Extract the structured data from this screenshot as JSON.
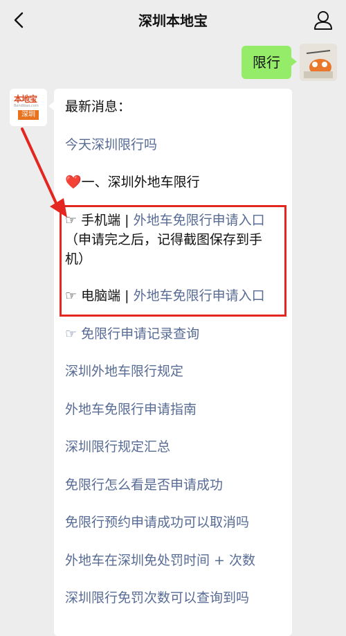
{
  "header": {
    "title": "深圳本地宝"
  },
  "outgoing_message": "限行",
  "bot_avatar": {
    "brand": "本地宝",
    "domain": "Bendibao.com",
    "city": "深圳"
  },
  "message": {
    "heading": "最新消息：",
    "link_today": "今天深圳限行吗",
    "section_heart": "❤️",
    "section_title": "一、深圳外地车限行",
    "hand_icon": "☞",
    "mobile_label": "手机端",
    "separator": "|",
    "mobile_link": "外地车免限行申请入口",
    "note_line1": "（申请完之后，记得截图保存到手",
    "note_line2": "机）",
    "pc_label": "电脑端",
    "pc_link": "外地车免限行申请入口",
    "record_link": "免限行申请记录查询",
    "links": [
      "深圳外地车限行规定",
      "外地车免限行申请指南",
      "深圳限行规定汇总",
      "免限行怎么看是否申请成功",
      "免限行预约申请成功可以取消吗",
      "外地车在深圳免处罚时间 + 次数",
      "深圳限行免罚次数可以查询到吗"
    ]
  },
  "colors": {
    "background": "#ededed",
    "outgoing_bubble": "#95ec69",
    "link": "#576b95",
    "highlight": "#e3261f"
  }
}
